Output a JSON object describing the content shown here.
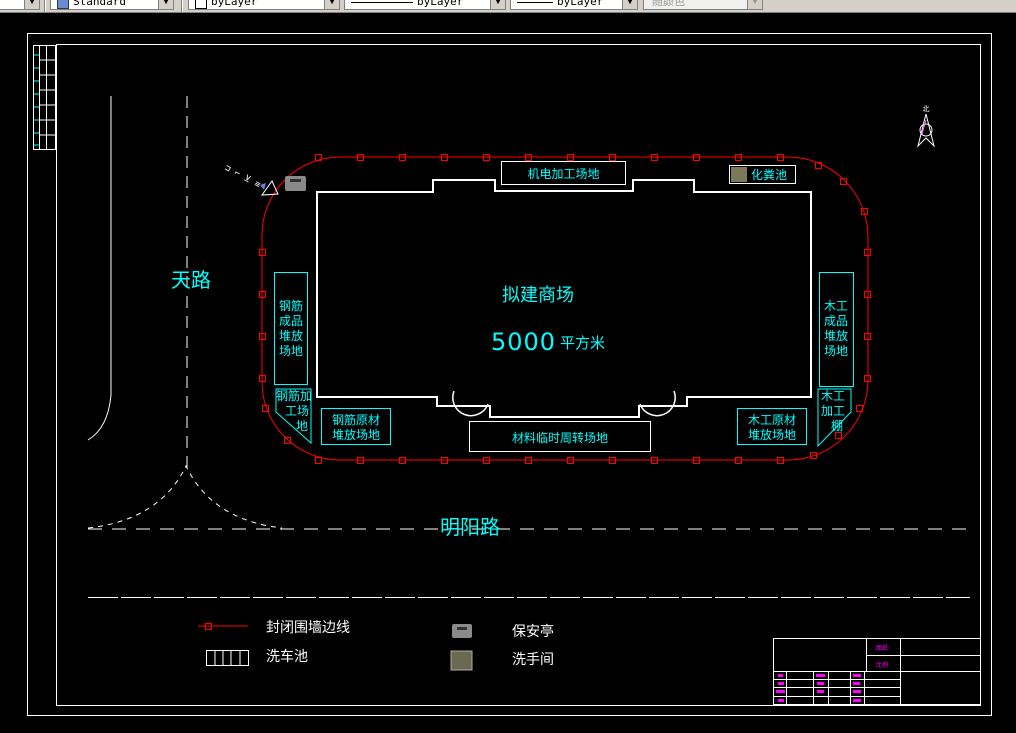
{
  "toolbar": {
    "textstyle": "Standard",
    "layer_color": "byLayer",
    "linetype": "byLayer",
    "lineweight": "byLayer",
    "plotstyle": "随颜色"
  },
  "drawing": {
    "road_west": "天路",
    "road_south": "明阳路",
    "building_name": "拟建商场",
    "building_area_num": "5000",
    "building_area_unit": "平方米",
    "north_text": "北",
    "labels": {
      "mech_elec": "机电加工场地",
      "septic": "化粪池",
      "rebar_finished": [
        "钢筋",
        "成品",
        "堆放",
        "场地"
      ],
      "rebar_process": [
        "钢筋加",
        "工场",
        "地"
      ],
      "rebar_raw": [
        "钢筋原材",
        "堆放场地"
      ],
      "material_temp": "材料临时周转场地",
      "wood_raw": [
        "木工原材",
        "堆放场地"
      ],
      "wood_finished": [
        "木工",
        "成品",
        "堆放",
        "场地"
      ],
      "wood_process": [
        "木工",
        "加工",
        "棚"
      ]
    }
  },
  "legend": {
    "wall": "封闭围墙边线",
    "guard": "保安亭",
    "wash_pool": "洗车池",
    "washroom": "洗手间"
  },
  "titleblock": {
    "r1": "图纸",
    "r2": "比例"
  },
  "colors": {
    "wall": "#ff0000",
    "cyan": "#00ffff",
    "white": "#ffffff",
    "magenta": "#ff00ff"
  }
}
